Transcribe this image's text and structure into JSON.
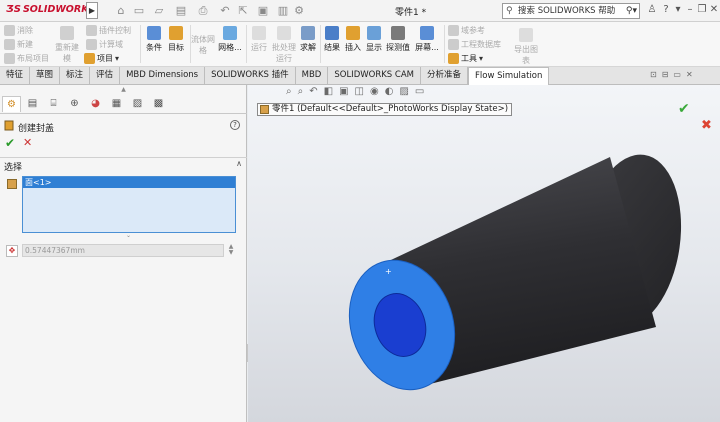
{
  "app": {
    "logo_text": "SOLIDWORKS",
    "doc_title": "零件1 *"
  },
  "search": {
    "placeholder": "搜索 SOLIDWORKS 帮助"
  },
  "ribbon": {
    "col1": [
      "消除",
      "新建",
      "布局项目"
    ],
    "b_rebuild": "重新建模",
    "col3": [
      "插件控制",
      "计算域"
    ],
    "item_project": "项目",
    "b_condition": "条件",
    "b_goal": "目标",
    "b_mesh": "网格...",
    "b_fluid": "流体网格",
    "b_run": "运行",
    "b_batch": "批处理运行",
    "b_solve": "求解",
    "b_results": "结果",
    "b_insert": "插入",
    "b_display": "显示",
    "b_probe": "探测值",
    "b_screen": "屏幕...",
    "col_right": [
      "域参考",
      "工程数据库"
    ],
    "item_tools": "工具",
    "b_export": "导出图表"
  },
  "tabs": [
    "特征",
    "草图",
    "标注",
    "评估",
    "MBD Dimensions",
    "SOLIDWORKS 插件",
    "MBD",
    "SOLIDWORKS CAM",
    "分析准备",
    "Flow Simulation"
  ],
  "panel": {
    "title": "创建封盖",
    "section": "选择",
    "selected_item": "面<1>",
    "thickness": "0.57447367mm"
  },
  "tree": {
    "node": "零件1  (Default<<Default>_PhotoWorks Display State>)"
  },
  "colors": {
    "cap_blue": "#1a64d8",
    "cylinder": "#3a3a3e",
    "accent_red": "#c8102e"
  }
}
